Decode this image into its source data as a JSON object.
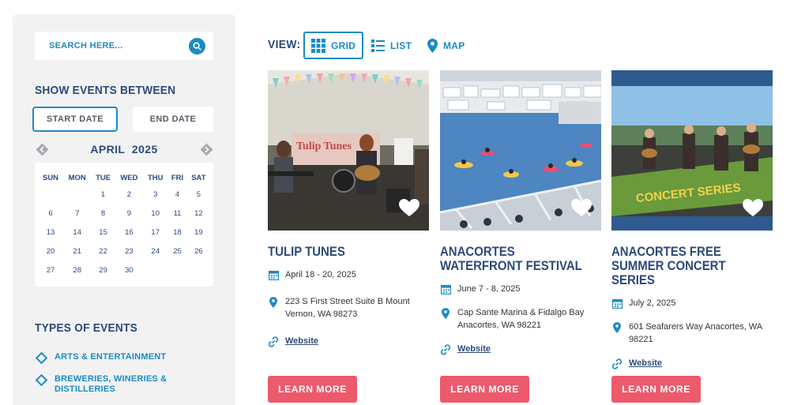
{
  "search": {
    "placeholder": "SEARCH HERE..."
  },
  "filters": {
    "heading": "SHOW EVENTS BETWEEN",
    "start_date_label": "START DATE",
    "end_date_label": "END DATE"
  },
  "calendar": {
    "month_label": "APRIL",
    "year_label": "2025",
    "weekdays": [
      "SUN",
      "MON",
      "TUE",
      "WED",
      "THU",
      "FRI",
      "SAT"
    ],
    "weeks": [
      [
        "",
        "",
        "1",
        "2",
        "3",
        "4",
        "5"
      ],
      [
        "6",
        "7",
        "8",
        "9",
        "10",
        "11",
        "12"
      ],
      [
        "13",
        "14",
        "15",
        "16",
        "17",
        "18",
        "19"
      ],
      [
        "20",
        "21",
        "22",
        "23",
        "24",
        "25",
        "26"
      ],
      [
        "27",
        "28",
        "29",
        "30",
        "",
        "",
        ""
      ]
    ]
  },
  "types": {
    "heading": "TYPES OF EVENTS",
    "items": [
      "ARTS & ENTERTAINMENT",
      "BREWERIES, WINERIES & DISTILLERIES"
    ]
  },
  "view": {
    "label": "VIEW:",
    "options": [
      "GRID",
      "LIST",
      "MAP"
    ],
    "active": "GRID"
  },
  "cards": [
    {
      "title": "TULIP TUNES",
      "date": "April 18 - 20, 2025",
      "address": "223 S First Street Suite B Mount Vernon, WA 98273",
      "website_label": "Website",
      "cta": "LEARN MORE",
      "image_icon": "band-under-tent-photo"
    },
    {
      "title": "ANACORTES WATERFRONT FESTIVAL",
      "date": "June 7 - 8, 2025",
      "address": "Cap Sante Marina & Fidalgo Bay Anacortes, WA 98221",
      "website_label": "Website",
      "cta": "LEARN MORE",
      "image_icon": "marina-boats-photo"
    },
    {
      "title": "ANACORTES FREE SUMMER CONCERT SERIES",
      "date": "July 2, 2025",
      "address": "601 Seafarers Way Anacortes, WA 98221",
      "website_label": "Website",
      "cta": "LEARN MORE",
      "image_icon": "outdoor-concert-photo"
    }
  ],
  "colors": {
    "accent": "#1a8bc4",
    "heading": "#2c4a7a",
    "cta": "#ec5a6c",
    "sidebar_bg": "#f2f2f3"
  }
}
